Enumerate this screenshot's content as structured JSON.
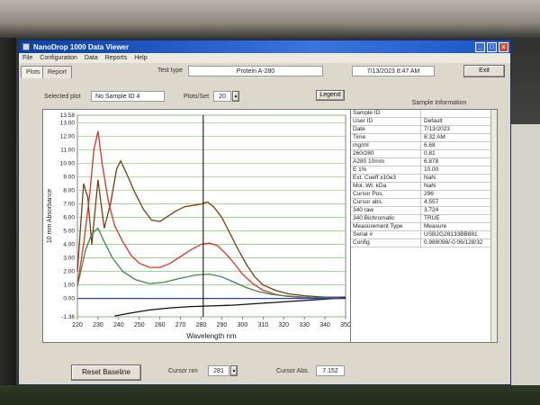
{
  "window": {
    "title": "NanoDrop 1000 Data Viewer",
    "controls": [
      "_",
      "□",
      "x"
    ]
  },
  "menu": [
    "File",
    "Configuration",
    "Data",
    "Reports",
    "Help"
  ],
  "tabs": [
    "Plots",
    "Report"
  ],
  "toolbar": {
    "test_type_label": "Test type",
    "test_type_value": "Protein A-280",
    "datetime": "7/13/2023 8:47 AM",
    "exit_label": "Exit",
    "selected_plot_label": "Selected plot",
    "selected_plot_value": "No Sample ID 4",
    "plots_per_set_label": "Plots/Set",
    "plots_per_set_value": "20",
    "legend_label": "Legend"
  },
  "chart_data": {
    "type": "line",
    "ylabel": "10 mm Absorbance",
    "xlabel": "Wavelength nm",
    "xlim": [
      220,
      350
    ],
    "ylim": [
      -1.36,
      13.58
    ],
    "x_ticks": [
      220,
      230,
      240,
      250,
      260,
      270,
      280,
      290,
      300,
      310,
      320,
      330,
      340,
      350
    ],
    "y_ticks": [
      -1.36,
      0.0,
      1.0,
      2.0,
      3.0,
      4.0,
      5.0,
      6.0,
      7.0,
      8.0,
      9.0,
      10.0,
      11.0,
      12.0,
      13.0,
      13.58
    ],
    "y_tick_labels": [
      "-1.36",
      "0.00",
      "1.00",
      "2.00",
      "3.00",
      "4.00",
      "5.00",
      "6.00",
      "7.00",
      "8.00",
      "9.00",
      "10.00",
      "11.00",
      "12.00",
      "13.00",
      "13.58"
    ],
    "grid_color": "#7fcf6a",
    "cursor_x": 281,
    "series": [
      {
        "color": "#7a3c12",
        "x": [
          220,
          223,
          225,
          227,
          230,
          233,
          236,
          239,
          241,
          244,
          248,
          252,
          256,
          260,
          264,
          268,
          272,
          276,
          280,
          283,
          286,
          290,
          294,
          298,
          302,
          306,
          310,
          316,
          322,
          330,
          340,
          350
        ],
        "y": [
          2.0,
          8.5,
          7.5,
          4.0,
          8.8,
          5.2,
          7.0,
          9.6,
          10.2,
          9.2,
          7.8,
          6.6,
          5.8,
          5.7,
          6.1,
          6.5,
          6.8,
          6.9,
          7.0,
          7.15,
          6.8,
          6.0,
          4.8,
          3.6,
          2.5,
          1.6,
          1.0,
          0.6,
          0.35,
          0.2,
          0.1,
          0.1
        ]
      },
      {
        "color": "#e0302e",
        "x": [
          220,
          223,
          226,
          228,
          230,
          232,
          235,
          238,
          242,
          246,
          250,
          255,
          260,
          265,
          270,
          275,
          280,
          284,
          288,
          292,
          296,
          300,
          305,
          310,
          316,
          322,
          330,
          340,
          350
        ],
        "y": [
          1.0,
          4.0,
          7.8,
          11.0,
          12.4,
          10.0,
          7.2,
          5.4,
          4.2,
          3.2,
          2.6,
          2.3,
          2.3,
          2.6,
          3.1,
          3.6,
          4.0,
          4.1,
          3.9,
          3.3,
          2.6,
          1.8,
          1.1,
          0.6,
          0.3,
          0.15,
          0.05,
          0.0,
          0.0
        ]
      },
      {
        "color": "#3f8a4a",
        "x": [
          220,
          224,
          227,
          230,
          233,
          237,
          242,
          248,
          255,
          262,
          270,
          278,
          284,
          290,
          296,
          302,
          308,
          314,
          320,
          330,
          340,
          350
        ],
        "y": [
          0.9,
          3.6,
          4.8,
          5.2,
          4.2,
          3.0,
          2.0,
          1.4,
          1.1,
          1.2,
          1.5,
          1.75,
          1.8,
          1.6,
          1.2,
          0.8,
          0.5,
          0.3,
          0.2,
          0.1,
          0.05,
          0.0
        ]
      },
      {
        "color": "#111111",
        "x": [
          238,
          245,
          255,
          265,
          275,
          285,
          295,
          305,
          315,
          325,
          335,
          345,
          350
        ],
        "y": [
          -1.3,
          -1.1,
          -0.85,
          -0.7,
          -0.6,
          -0.55,
          -0.5,
          -0.4,
          -0.3,
          -0.2,
          -0.1,
          0.0,
          0.05
        ]
      },
      {
        "color": "#2b3bd6",
        "x": [
          220,
          350
        ],
        "y": [
          0.0,
          0.0
        ]
      }
    ]
  },
  "info": {
    "title": "Sample Information",
    "rows": [
      {
        "k": "Sample ID",
        "v": ""
      },
      {
        "k": "User ID",
        "v": "Default"
      },
      {
        "k": "Date",
        "v": "7/13/2023"
      },
      {
        "k": "Time",
        "v": "8:32 AM"
      },
      {
        "k": "mg/ml",
        "v": "6.68"
      },
      {
        "k": "260/280",
        "v": "0.81"
      },
      {
        "k": "A280 10mm",
        "v": "6.878"
      },
      {
        "k": "E 1%",
        "v": "10.00"
      },
      {
        "k": "Ext. Coeff x10e3",
        "v": "NaN"
      },
      {
        "k": "Mol. Wt. kDa",
        "v": "NaN"
      },
      {
        "k": "Cursor Pos.",
        "v": "296"
      },
      {
        "k": "Cursor abs.",
        "v": "4.557"
      },
      {
        "k": "340 raw",
        "v": "3.724"
      },
      {
        "k": "340 Bichromatic",
        "v": "TRUE"
      },
      {
        "k": "Measurement Type",
        "v": "Measure"
      },
      {
        "k": "Serial #",
        "v": "USB2G28133BB881"
      },
      {
        "k": "Config",
        "v": "0.988098/-0.06/128/32"
      }
    ]
  },
  "bottom": {
    "reset_label": "Reset Baseline",
    "cursor_nm_label": "Cursor nm",
    "cursor_nm_value": "281",
    "cursor_abs_label": "Cursor Abs.",
    "cursor_abs_value": "7.152"
  }
}
